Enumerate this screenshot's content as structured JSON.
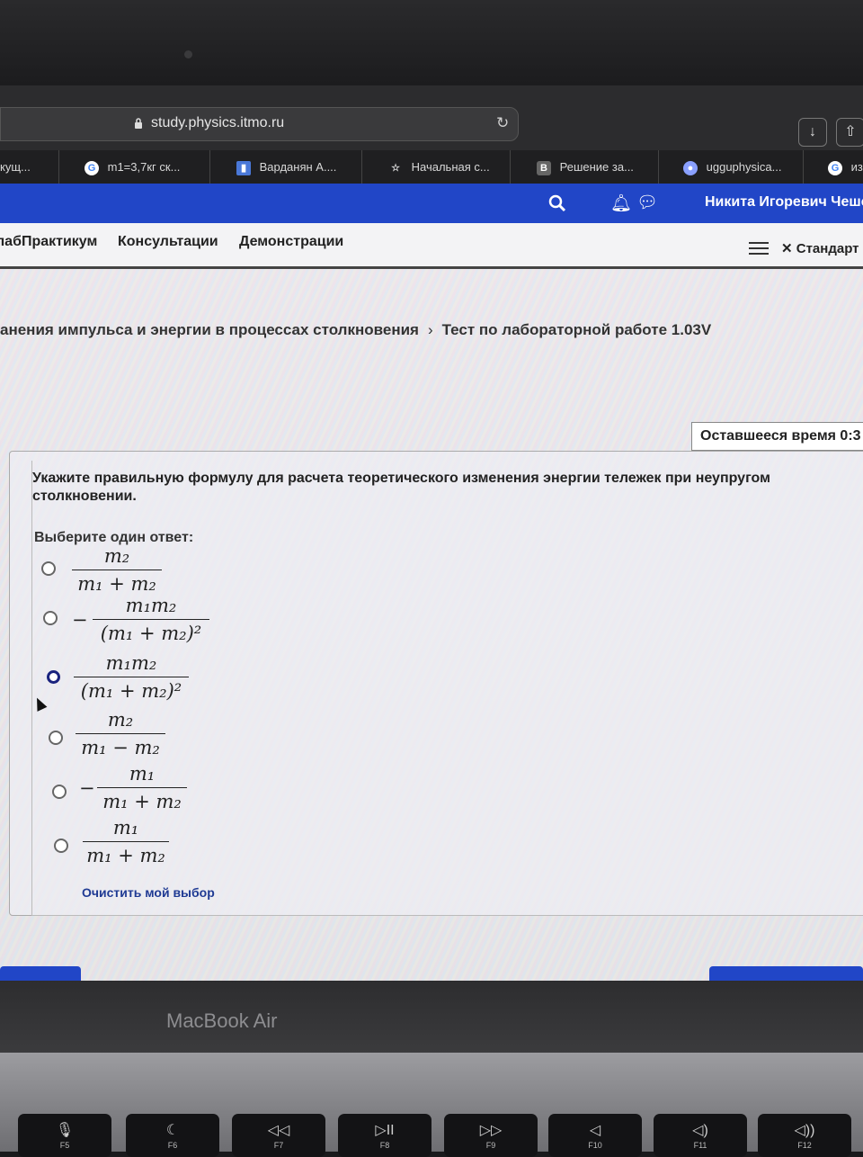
{
  "browser": {
    "url": "study.physics.itmo.ru",
    "tabs": [
      {
        "label": "кущ...",
        "icon": "none"
      },
      {
        "label": "m1=3,7кг ск...",
        "icon": "google-icon"
      },
      {
        "label": "Варданян А....",
        "icon": "book-icon"
      },
      {
        "label": "Начальная с...",
        "icon": "star-icon"
      },
      {
        "label": "Решение за...",
        "icon": "B"
      },
      {
        "label": "ugguphysica...",
        "icon": "drive-icon"
      },
      {
        "label": "из",
        "icon": "google-icon"
      }
    ]
  },
  "header": {
    "user_name": "Никита Игоревич Чеше",
    "icons": [
      "search-icon",
      "bell-icon",
      "chat-icon"
    ]
  },
  "nav": {
    "items": [
      "лабПрактикум",
      "Консультации",
      "Демонстрации"
    ],
    "right_label": "Стандарт"
  },
  "breadcrumb": {
    "section": "анения импульса и энергии в процессах столкновения",
    "separator": "›",
    "current": "Тест по лабораторной работе 1.03V"
  },
  "timer": {
    "label": "Оставшееся время 0:3"
  },
  "question": {
    "text": "Укажите правильную формулу для расчета теоретического изменения энергии тележек при неупругом столкновении.",
    "prompt": "Выберите один ответ:",
    "options": [
      {
        "sign": "",
        "num": "m₂",
        "den": "m₁ + m₂",
        "selected": false
      },
      {
        "sign": "−",
        "num": "m₁m₂",
        "den": "(m₁ + m₂)²",
        "selected": false
      },
      {
        "sign": "",
        "num": "m₁m₂",
        "den": "(m₁ + m₂)²",
        "selected": true
      },
      {
        "sign": "",
        "num": "m₂",
        "den": "m₁ − m₂",
        "selected": false
      },
      {
        "sign": "−",
        "num": "m₁",
        "den": "m₁ + m₂",
        "selected": false
      },
      {
        "sign": "",
        "num": "m₁",
        "den": "m₁ + m₂",
        "selected": false
      }
    ],
    "clear_label": "Очистить мой выбор"
  },
  "device": {
    "brand": "MacBook Air",
    "keys": [
      {
        "glyph": "🎙",
        "label": "F5"
      },
      {
        "glyph": "☾",
        "label": "F6"
      },
      {
        "glyph": "◁◁",
        "label": "F7"
      },
      {
        "glyph": "▷II",
        "label": "F8"
      },
      {
        "glyph": "▷▷",
        "label": "F9"
      },
      {
        "glyph": "◁",
        "label": "F10"
      },
      {
        "glyph": "◁)",
        "label": "F11"
      },
      {
        "glyph": "◁))",
        "label": "F12"
      }
    ]
  }
}
